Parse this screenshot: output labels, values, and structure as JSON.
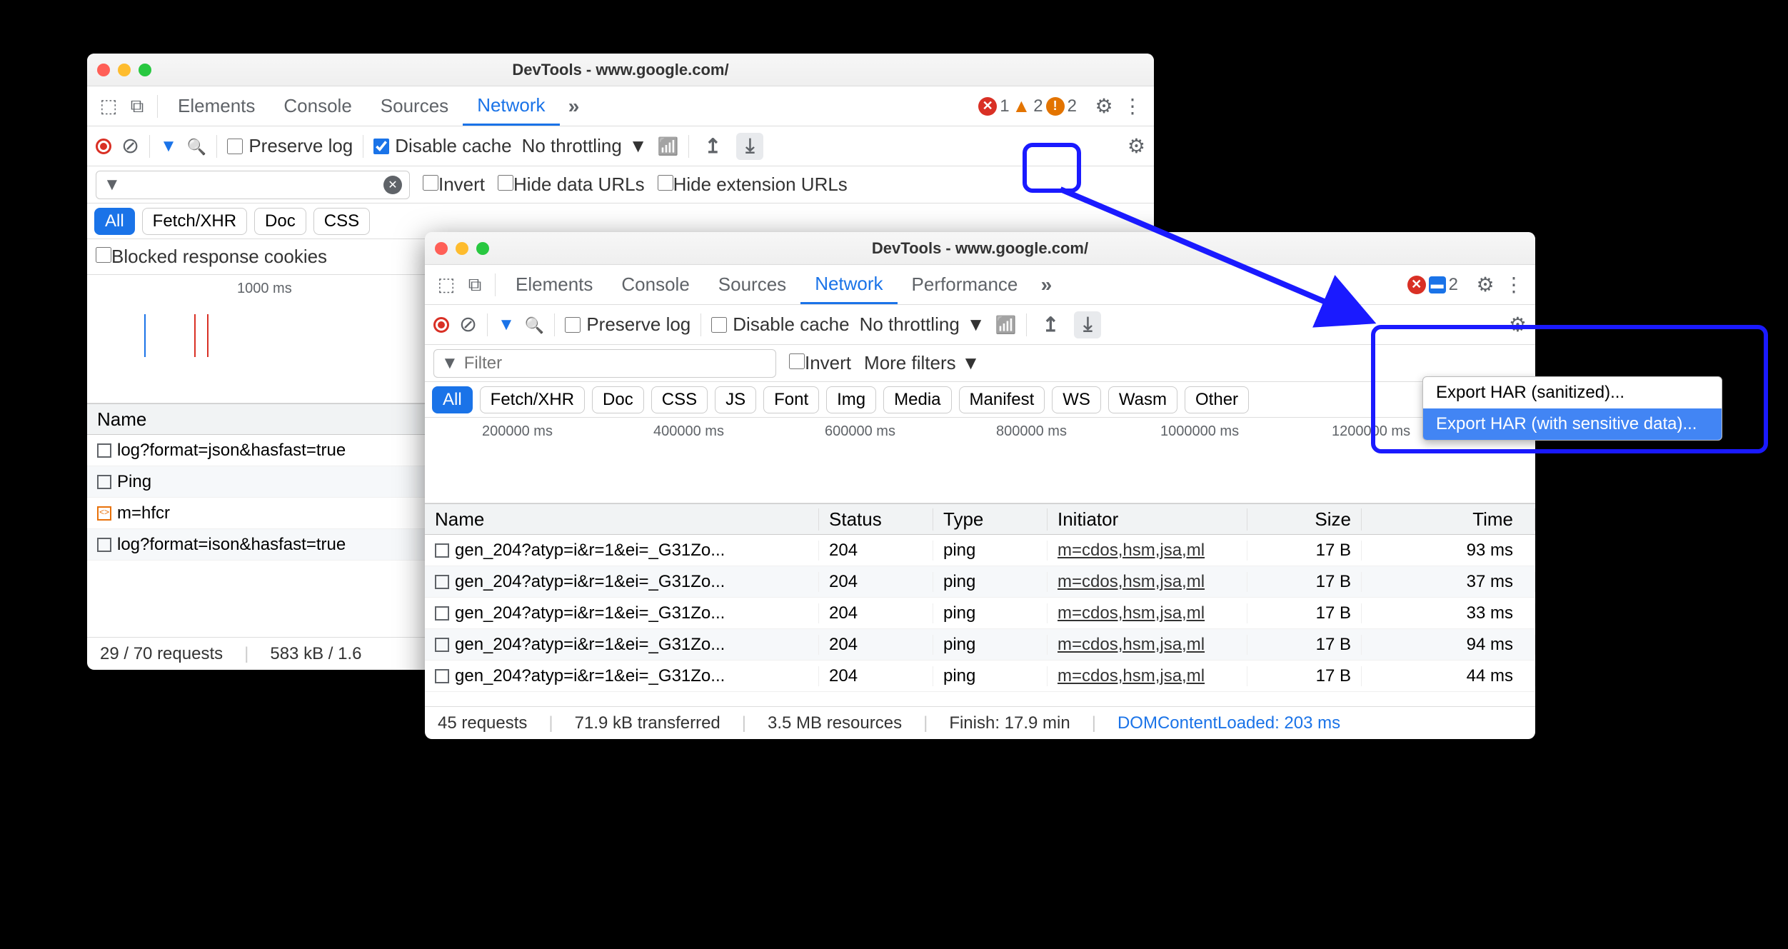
{
  "window1": {
    "title": "DevTools - www.google.com/",
    "tabs": [
      "Elements",
      "Console",
      "Sources",
      "Network"
    ],
    "active_tab": "Network",
    "error_count": "1",
    "warn_count": "2",
    "info_count": "2",
    "preserve_log": "Preserve log",
    "disable_cache": "Disable cache",
    "throttling": "No throttling",
    "filter_opts": {
      "invert": "Invert",
      "hide_data": "Hide data URLs",
      "hide_ext": "Hide extension URLs"
    },
    "chips": [
      "All",
      "Fetch/XHR",
      "Doc",
      "CSS"
    ],
    "blocked_cookies": "Blocked response cookies",
    "timeline_label": "1000 ms",
    "name_header": "Name",
    "rows": [
      "log?format=json&hasfast=true",
      "Ping",
      "m=hfcr",
      "log?format=ison&hasfast=true"
    ],
    "status": {
      "requests": "29 / 70 requests",
      "transferred": "583 kB / 1.6"
    }
  },
  "window2": {
    "title": "DevTools - www.google.com/",
    "tabs": [
      "Elements",
      "Console",
      "Sources",
      "Network",
      "Performance"
    ],
    "active_tab": "Network",
    "info_count": "2",
    "preserve_log": "Preserve log",
    "disable_cache": "Disable cache",
    "throttling": "No throttling",
    "filter_placeholder": "Filter",
    "invert": "Invert",
    "more_filters": "More filters",
    "chips": [
      "All",
      "Fetch/XHR",
      "Doc",
      "CSS",
      "JS",
      "Font",
      "Img",
      "Media",
      "Manifest",
      "WS",
      "Wasm",
      "Other"
    ],
    "timeline": [
      "200000 ms",
      "400000 ms",
      "600000 ms",
      "800000 ms",
      "1000000 ms",
      "1200000 ms"
    ],
    "headers": {
      "name": "Name",
      "status": "Status",
      "type": "Type",
      "initiator": "Initiator",
      "size": "Size",
      "time": "Time"
    },
    "rows": [
      {
        "name": "gen_204?atyp=i&r=1&ei=_G31Zo...",
        "status": "204",
        "type": "ping",
        "initiator": "m=cdos,hsm,jsa,ml",
        "size": "17 B",
        "time": "93 ms"
      },
      {
        "name": "gen_204?atyp=i&r=1&ei=_G31Zo...",
        "status": "204",
        "type": "ping",
        "initiator": "m=cdos,hsm,jsa,ml",
        "size": "17 B",
        "time": "37 ms"
      },
      {
        "name": "gen_204?atyp=i&r=1&ei=_G31Zo...",
        "status": "204",
        "type": "ping",
        "initiator": "m=cdos,hsm,jsa,ml",
        "size": "17 B",
        "time": "33 ms"
      },
      {
        "name": "gen_204?atyp=i&r=1&ei=_G31Zo...",
        "status": "204",
        "type": "ping",
        "initiator": "m=cdos,hsm,jsa,ml",
        "size": "17 B",
        "time": "94 ms"
      },
      {
        "name": "gen_204?atyp=i&r=1&ei=_G31Zo...",
        "status": "204",
        "type": "ping",
        "initiator": "m=cdos,hsm,jsa,ml",
        "size": "17 B",
        "time": "44 ms"
      }
    ],
    "status": {
      "requests": "45 requests",
      "transferred": "71.9 kB transferred",
      "resources": "3.5 MB resources",
      "finish": "Finish: 17.9 min",
      "dcl": "DOMContentLoaded: 203 ms"
    },
    "export_menu": {
      "sanitized": "Export HAR (sanitized)...",
      "sensitive": "Export HAR (with sensitive data)..."
    }
  }
}
